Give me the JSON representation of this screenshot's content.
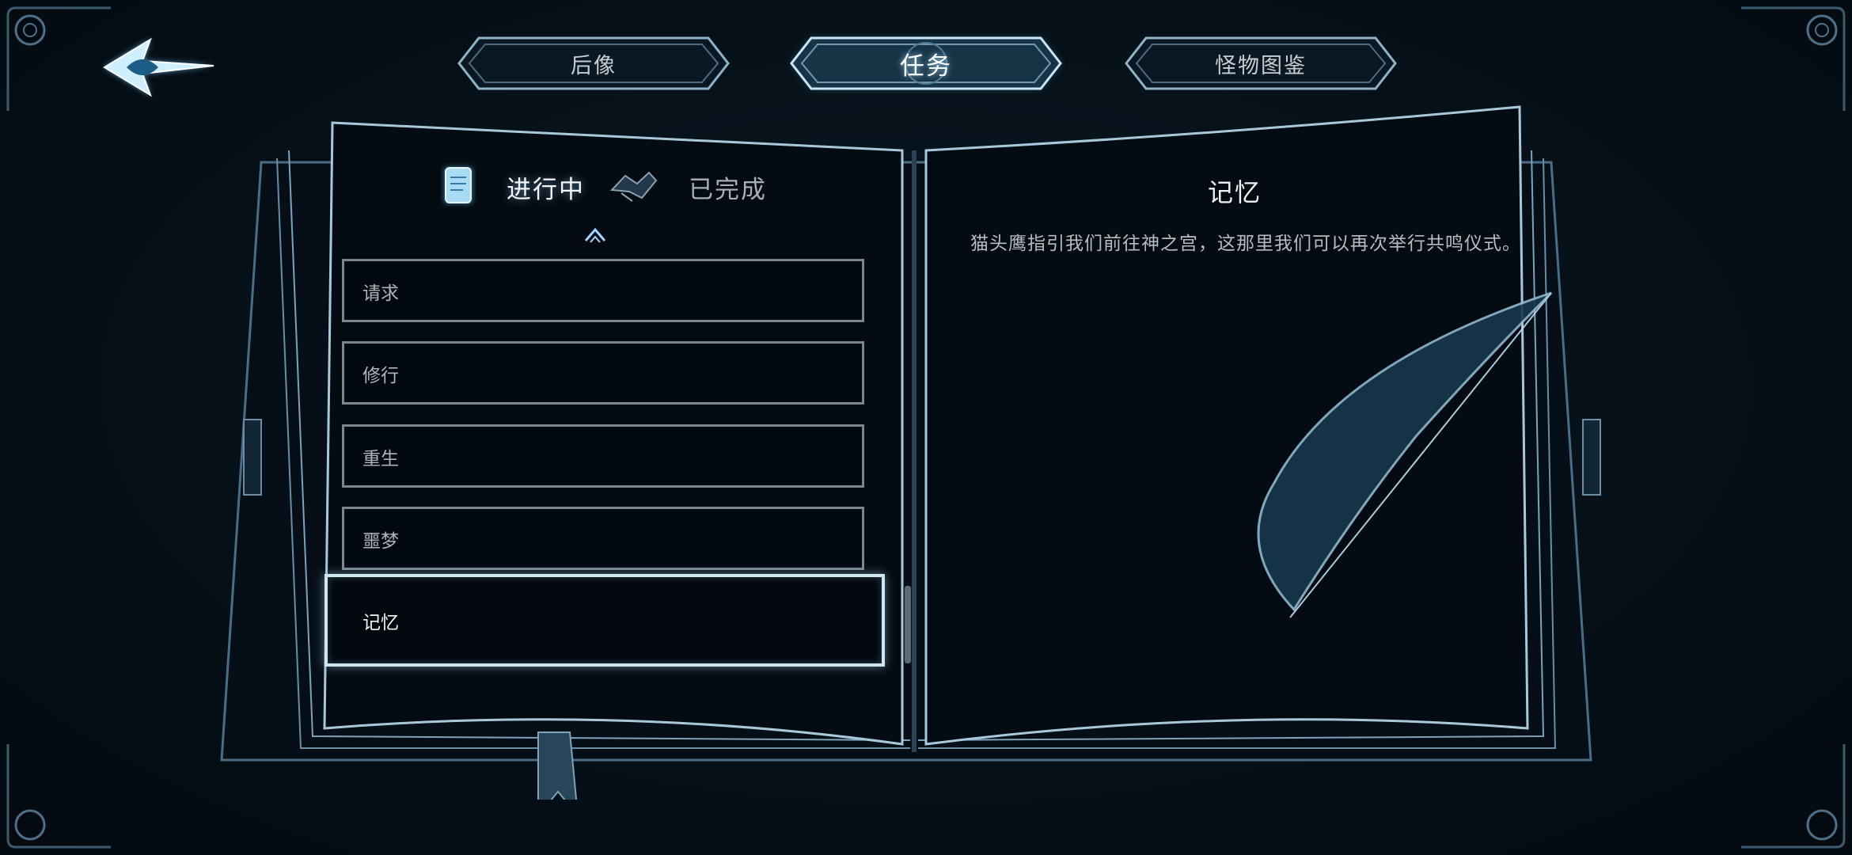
{
  "top_tabs": [
    {
      "label": "后像",
      "active": false
    },
    {
      "label": "任务",
      "active": true
    },
    {
      "label": "怪物图鉴",
      "active": false
    }
  ],
  "journal": {
    "subtabs": {
      "in_progress": "进行中",
      "completed": "已完成"
    },
    "quests": [
      "请求",
      "修行",
      "重生",
      "噩梦",
      "记忆"
    ],
    "selected_index": 4
  },
  "detail": {
    "title": "记忆",
    "text": "猫头鹰指引我们前往神之宫，这那里我们可以再次举行共鸣仪式。"
  },
  "colors": {
    "glow": "#9fd6ff",
    "line": "#6f94ad",
    "background": "#07121b"
  }
}
